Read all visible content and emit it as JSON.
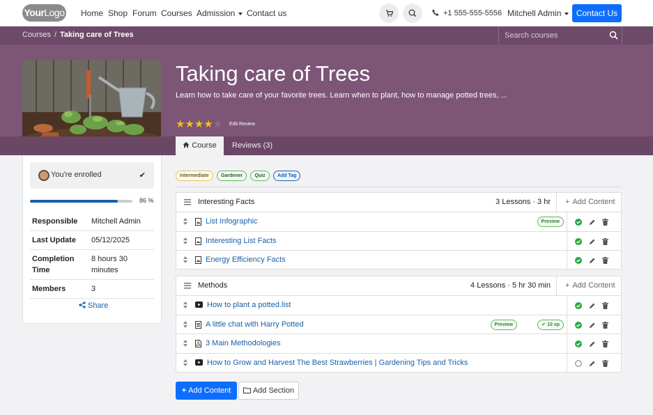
{
  "navbar": {
    "logo_bold": "Your",
    "logo_light": "Logo",
    "links": [
      "Home",
      "Shop",
      "Forum",
      "Courses",
      "Admission",
      "Contact us"
    ],
    "phone": "+1 555-555-5556",
    "user": "Mitchell Admin",
    "contact_button": "Contact Us",
    "icons": [
      "cart-icon",
      "search-icon",
      "phone-icon"
    ]
  },
  "breadcrumb": {
    "parent": "Courses",
    "separator": "/",
    "current": "Taking care of Trees"
  },
  "search": {
    "placeholder": "Search courses"
  },
  "course": {
    "title": "Taking care of Trees",
    "description": "Learn how to take care of your favorite trees. Learn when to plant, how to manage potted trees, ...",
    "rating": 4,
    "rating_max": 5,
    "edit_review": "Edit Review",
    "tabs": {
      "course": "Course",
      "reviews": "Reviews (3)"
    }
  },
  "sidebar": {
    "enrolled_text": "You're enrolled",
    "progress": 86,
    "progress_label": "86 %",
    "info": [
      {
        "key": "Responsible",
        "value": "Mitchell Admin"
      },
      {
        "key": "Last Update",
        "value": "05/12/2025"
      },
      {
        "key": "Completion Time",
        "value": "8 hours 30 minutes"
      },
      {
        "key": "Members",
        "value": "3"
      }
    ],
    "share": "Share"
  },
  "tags": {
    "intermediate": "Intermediate",
    "gardener": "Gardener",
    "quiz": "Quiz",
    "add": "Add Tag"
  },
  "sections": [
    {
      "title": "Interesting Facts",
      "meta": "3 Lessons · 3 hr",
      "add_content": "Add Content",
      "lessons": [
        {
          "name": "List Infographic",
          "type": "infographic",
          "preview": "Preview",
          "done": true
        },
        {
          "name": "Interesting List Facts",
          "type": "infographic",
          "done": true
        },
        {
          "name": "Energy Efficiency Facts",
          "type": "infographic",
          "done": true
        }
      ]
    },
    {
      "title": "Methods",
      "meta": "4 Lessons · 5 hr 30 min",
      "add_content": "Add Content",
      "lessons": [
        {
          "name": "How to plant a potted.list",
          "type": "video",
          "done": true
        },
        {
          "name": "A little chat with Harry Potted",
          "type": "document",
          "preview": "Preview",
          "xp": "10 xp",
          "done": true
        },
        {
          "name": "3 Main Methodologies",
          "type": "pdf",
          "done": true
        },
        {
          "name": "How to Grow and Harvest The Best Strawberries | Gardening Tips and Tricks",
          "type": "video",
          "done": false
        }
      ]
    }
  ],
  "actions": {
    "add_content": "Add Content",
    "add_section": "Add Section"
  },
  "colors": {
    "primary": "#0d6efd",
    "hero": "#7c5577",
    "link": "#1a5fa7",
    "star": "#f4c20d",
    "success": "#28a745"
  }
}
